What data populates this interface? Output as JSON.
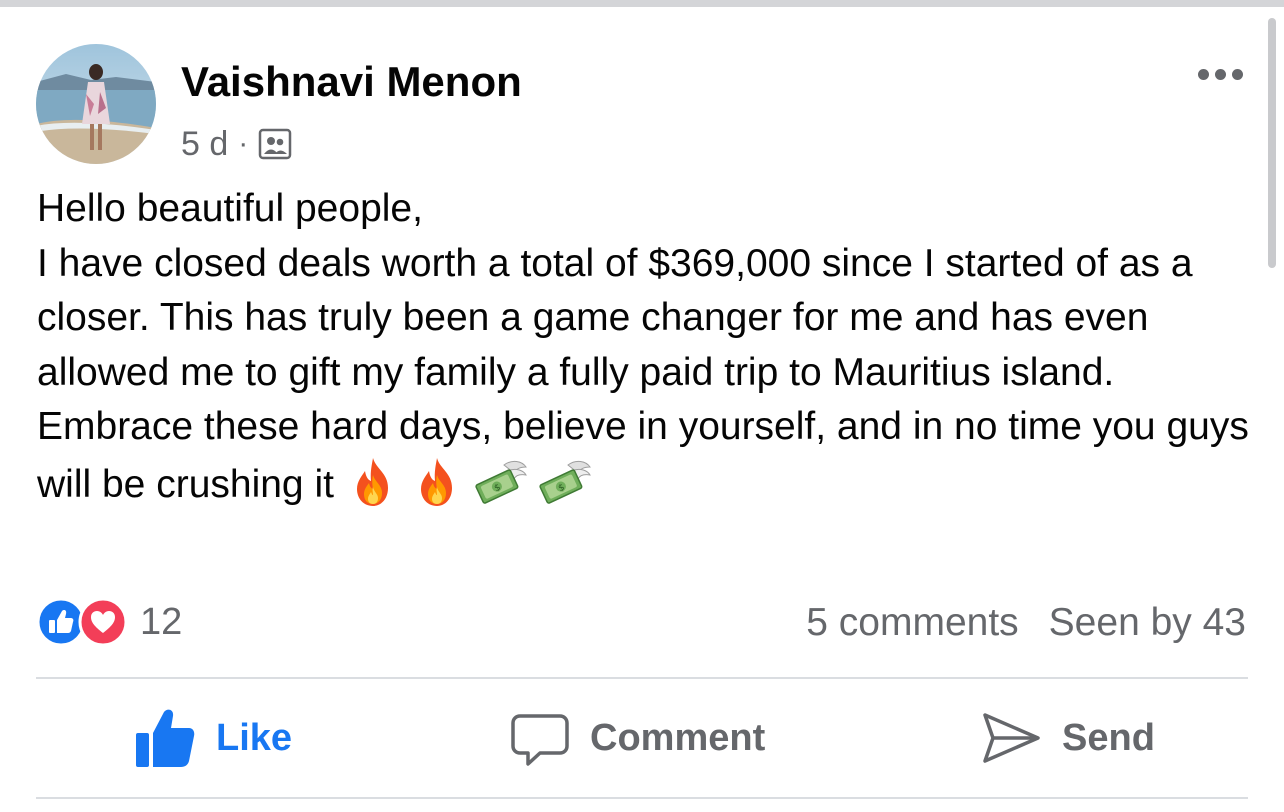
{
  "post": {
    "author_name": "Vaishnavi Menon",
    "timestamp": "5 d",
    "separator": "·",
    "audience_icon": "group-icon",
    "more_icon": "more-horizontal-icon",
    "text_lines": [
      "Hello beautiful people,",
      "I have closed deals worth a total of $369,000 since I started of as a closer. This has truly been a game changer for me and has even allowed me to gift my family a fully paid trip to Mauritius island. Embrace these hard days, believe in yourself, and in no time you guys will be crushing it"
    ],
    "emojis": [
      "fire-emoji",
      "fire-emoji",
      "money-with-wings-emoji",
      "money-with-wings-emoji"
    ]
  },
  "reactions": {
    "icons": [
      "like-reaction-icon",
      "love-reaction-icon"
    ],
    "count": "12"
  },
  "stats": {
    "comments": "5 comments",
    "seen_by": "Seen by 43"
  },
  "actions": {
    "like_label": "Like",
    "comment_label": "Comment",
    "send_label": "Send"
  },
  "colors": {
    "brand_blue": "#1877f2",
    "love_red": "#f33e58",
    "secondary_text": "#65676b",
    "primary_text": "#050505",
    "divider": "#dadde1"
  }
}
